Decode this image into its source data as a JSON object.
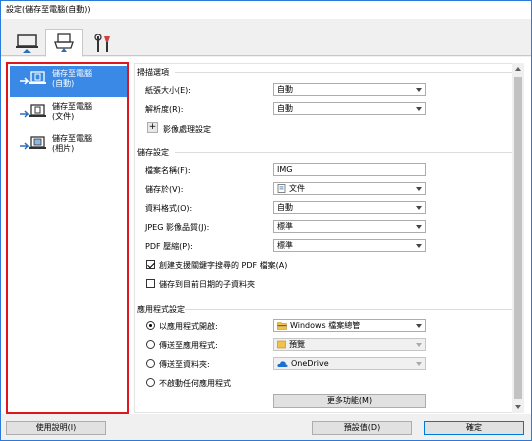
{
  "window": {
    "title": "設定(儲存至電腦(自動))"
  },
  "tabs": [
    {
      "name": "tab-scan-from-operation-panel",
      "icon": "computer-upload-icon",
      "selected": false
    },
    {
      "name": "tab-scan-from-computer",
      "icon": "scanner-computer-icon",
      "selected": true
    },
    {
      "name": "tab-general-settings",
      "icon": "tools-icon",
      "selected": false
    }
  ],
  "sidebar": {
    "items": [
      {
        "label": "儲存至電腦\n(自動)",
        "icon": "save-auto-icon",
        "selected": true
      },
      {
        "label": "儲存至電腦\n(文件)",
        "icon": "save-document-icon",
        "selected": false
      },
      {
        "label": "儲存至電腦\n(相片)",
        "icon": "save-photo-icon",
        "selected": false
      }
    ]
  },
  "scan_options": {
    "title": "掃描選項",
    "paper_size_label": "紙張大小(E):",
    "paper_size_value": "自動",
    "resolution_label": "解析度(R):",
    "resolution_value": "自動",
    "image_processing_label": "影像處理設定",
    "expand_symbol": "+"
  },
  "save_settings": {
    "title": "儲存設定",
    "file_name_label": "檔案名稱(F):",
    "file_name_value": "IMG",
    "save_in_label": "儲存於(V):",
    "save_in_value": "文件",
    "data_format_label": "資料格式(O):",
    "data_format_value": "自動",
    "jpeg_quality_label": "JPEG 影像品質(J):",
    "jpeg_quality_value": "標準",
    "pdf_compression_label": "PDF 壓縮(P):",
    "pdf_compression_value": "標準",
    "searchable_pdf_label": "創建支援關鍵字搜尋的 PDF 檔案(A)",
    "searchable_pdf_checked": true,
    "subfolder_label": "儲存到目前日期的子資料夾",
    "subfolder_checked": false
  },
  "application_settings": {
    "title": "應用程式設定",
    "open_with_label": "以應用程式開啟:",
    "open_with_value": "Windows 檔案總管",
    "send_to_app_label": "傳送至應用程式:",
    "send_to_app_value": "預覽",
    "send_to_folder_label": "傳送至資料夾:",
    "send_to_folder_value": "OneDrive",
    "do_not_start_label": "不啟動任何應用程式",
    "selected_option": "open_with",
    "more_functions_label": "更多功能(M)"
  },
  "footer": {
    "help_label": "使用說明(I)",
    "defaults_label": "預設值(D)",
    "ok_label": "確定"
  },
  "colors": {
    "accent": "#3a89e6",
    "highlight_border": "#e0161d",
    "window_border": "#2b79d8"
  }
}
